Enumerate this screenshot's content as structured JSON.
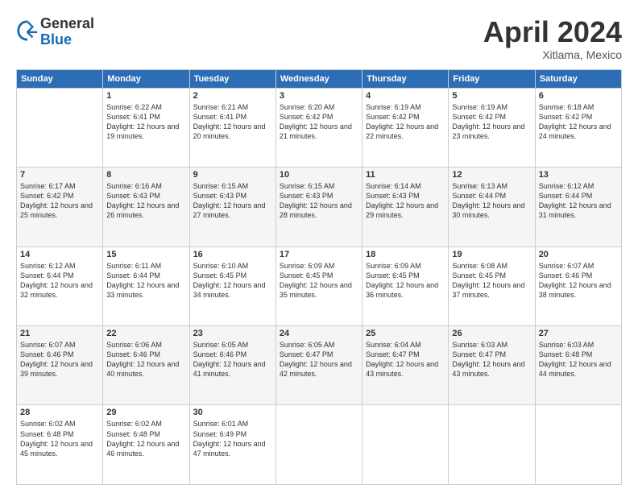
{
  "header": {
    "logo_line1": "General",
    "logo_line2": "Blue",
    "month": "April 2024",
    "location": "Xitlama, Mexico"
  },
  "weekdays": [
    "Sunday",
    "Monday",
    "Tuesday",
    "Wednesday",
    "Thursday",
    "Friday",
    "Saturday"
  ],
  "weeks": [
    [
      {
        "day": "",
        "sunrise": "",
        "sunset": "",
        "daylight": ""
      },
      {
        "day": "1",
        "sunrise": "Sunrise: 6:22 AM",
        "sunset": "Sunset: 6:41 PM",
        "daylight": "Daylight: 12 hours and 19 minutes."
      },
      {
        "day": "2",
        "sunrise": "Sunrise: 6:21 AM",
        "sunset": "Sunset: 6:41 PM",
        "daylight": "Daylight: 12 hours and 20 minutes."
      },
      {
        "day": "3",
        "sunrise": "Sunrise: 6:20 AM",
        "sunset": "Sunset: 6:42 PM",
        "daylight": "Daylight: 12 hours and 21 minutes."
      },
      {
        "day": "4",
        "sunrise": "Sunrise: 6:19 AM",
        "sunset": "Sunset: 6:42 PM",
        "daylight": "Daylight: 12 hours and 22 minutes."
      },
      {
        "day": "5",
        "sunrise": "Sunrise: 6:19 AM",
        "sunset": "Sunset: 6:42 PM",
        "daylight": "Daylight: 12 hours and 23 minutes."
      },
      {
        "day": "6",
        "sunrise": "Sunrise: 6:18 AM",
        "sunset": "Sunset: 6:42 PM",
        "daylight": "Daylight: 12 hours and 24 minutes."
      }
    ],
    [
      {
        "day": "7",
        "sunrise": "Sunrise: 6:17 AM",
        "sunset": "Sunset: 6:42 PM",
        "daylight": "Daylight: 12 hours and 25 minutes."
      },
      {
        "day": "8",
        "sunrise": "Sunrise: 6:16 AM",
        "sunset": "Sunset: 6:43 PM",
        "daylight": "Daylight: 12 hours and 26 minutes."
      },
      {
        "day": "9",
        "sunrise": "Sunrise: 6:15 AM",
        "sunset": "Sunset: 6:43 PM",
        "daylight": "Daylight: 12 hours and 27 minutes."
      },
      {
        "day": "10",
        "sunrise": "Sunrise: 6:15 AM",
        "sunset": "Sunset: 6:43 PM",
        "daylight": "Daylight: 12 hours and 28 minutes."
      },
      {
        "day": "11",
        "sunrise": "Sunrise: 6:14 AM",
        "sunset": "Sunset: 6:43 PM",
        "daylight": "Daylight: 12 hours and 29 minutes."
      },
      {
        "day": "12",
        "sunrise": "Sunrise: 6:13 AM",
        "sunset": "Sunset: 6:44 PM",
        "daylight": "Daylight: 12 hours and 30 minutes."
      },
      {
        "day": "13",
        "sunrise": "Sunrise: 6:12 AM",
        "sunset": "Sunset: 6:44 PM",
        "daylight": "Daylight: 12 hours and 31 minutes."
      }
    ],
    [
      {
        "day": "14",
        "sunrise": "Sunrise: 6:12 AM",
        "sunset": "Sunset: 6:44 PM",
        "daylight": "Daylight: 12 hours and 32 minutes."
      },
      {
        "day": "15",
        "sunrise": "Sunrise: 6:11 AM",
        "sunset": "Sunset: 6:44 PM",
        "daylight": "Daylight: 12 hours and 33 minutes."
      },
      {
        "day": "16",
        "sunrise": "Sunrise: 6:10 AM",
        "sunset": "Sunset: 6:45 PM",
        "daylight": "Daylight: 12 hours and 34 minutes."
      },
      {
        "day": "17",
        "sunrise": "Sunrise: 6:09 AM",
        "sunset": "Sunset: 6:45 PM",
        "daylight": "Daylight: 12 hours and 35 minutes."
      },
      {
        "day": "18",
        "sunrise": "Sunrise: 6:09 AM",
        "sunset": "Sunset: 6:45 PM",
        "daylight": "Daylight: 12 hours and 36 minutes."
      },
      {
        "day": "19",
        "sunrise": "Sunrise: 6:08 AM",
        "sunset": "Sunset: 6:45 PM",
        "daylight": "Daylight: 12 hours and 37 minutes."
      },
      {
        "day": "20",
        "sunrise": "Sunrise: 6:07 AM",
        "sunset": "Sunset: 6:46 PM",
        "daylight": "Daylight: 12 hours and 38 minutes."
      }
    ],
    [
      {
        "day": "21",
        "sunrise": "Sunrise: 6:07 AM",
        "sunset": "Sunset: 6:46 PM",
        "daylight": "Daylight: 12 hours and 39 minutes."
      },
      {
        "day": "22",
        "sunrise": "Sunrise: 6:06 AM",
        "sunset": "Sunset: 6:46 PM",
        "daylight": "Daylight: 12 hours and 40 minutes."
      },
      {
        "day": "23",
        "sunrise": "Sunrise: 6:05 AM",
        "sunset": "Sunset: 6:46 PM",
        "daylight": "Daylight: 12 hours and 41 minutes."
      },
      {
        "day": "24",
        "sunrise": "Sunrise: 6:05 AM",
        "sunset": "Sunset: 6:47 PM",
        "daylight": "Daylight: 12 hours and 42 minutes."
      },
      {
        "day": "25",
        "sunrise": "Sunrise: 6:04 AM",
        "sunset": "Sunset: 6:47 PM",
        "daylight": "Daylight: 12 hours and 43 minutes."
      },
      {
        "day": "26",
        "sunrise": "Sunrise: 6:03 AM",
        "sunset": "Sunset: 6:47 PM",
        "daylight": "Daylight: 12 hours and 43 minutes."
      },
      {
        "day": "27",
        "sunrise": "Sunrise: 6:03 AM",
        "sunset": "Sunset: 6:48 PM",
        "daylight": "Daylight: 12 hours and 44 minutes."
      }
    ],
    [
      {
        "day": "28",
        "sunrise": "Sunrise: 6:02 AM",
        "sunset": "Sunset: 6:48 PM",
        "daylight": "Daylight: 12 hours and 45 minutes."
      },
      {
        "day": "29",
        "sunrise": "Sunrise: 6:02 AM",
        "sunset": "Sunset: 6:48 PM",
        "daylight": "Daylight: 12 hours and 46 minutes."
      },
      {
        "day": "30",
        "sunrise": "Sunrise: 6:01 AM",
        "sunset": "Sunset: 6:49 PM",
        "daylight": "Daylight: 12 hours and 47 minutes."
      },
      {
        "day": "",
        "sunrise": "",
        "sunset": "",
        "daylight": ""
      },
      {
        "day": "",
        "sunrise": "",
        "sunset": "",
        "daylight": ""
      },
      {
        "day": "",
        "sunrise": "",
        "sunset": "",
        "daylight": ""
      },
      {
        "day": "",
        "sunrise": "",
        "sunset": "",
        "daylight": ""
      }
    ]
  ]
}
